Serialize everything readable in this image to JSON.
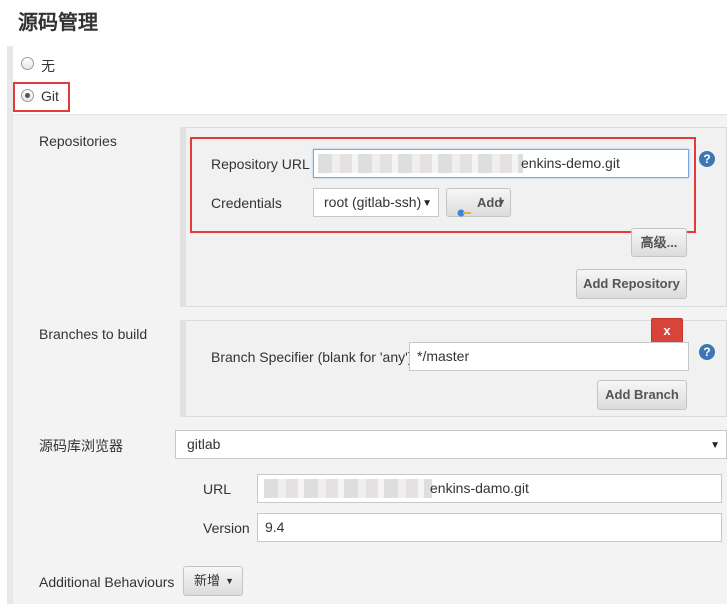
{
  "section_title": "源码管理",
  "scm_options": [
    {
      "label": "无",
      "selected": false
    },
    {
      "label": "Git",
      "selected": true
    }
  ],
  "repositories": {
    "label": "Repositories",
    "url_label": "Repository URL",
    "url_value": "enkins-demo.git",
    "credentials_label": "Credentials",
    "credentials_value": "root (gitlab-ssh)",
    "add_button": "Add",
    "advanced_button": "高级...",
    "add_repository_button": "Add Repository"
  },
  "branches": {
    "label": "Branches to build",
    "delete_button": "x",
    "specifier_label": "Branch Specifier (blank for 'any')",
    "specifier_value": "*/master",
    "add_branch_button": "Add Branch"
  },
  "browser": {
    "label": "源码库浏览器",
    "value": "gitlab",
    "url_label": "URL",
    "url_value": "enkins-damo.git",
    "version_label": "Version",
    "version_value": "9.4"
  },
  "additional": {
    "label": "Additional Behaviours",
    "button": "新增"
  },
  "help_glyph": "?",
  "colors": {
    "highlight_red": "#e23b3b",
    "help_blue": "#3d76b5",
    "delete_red": "#d9443a"
  }
}
